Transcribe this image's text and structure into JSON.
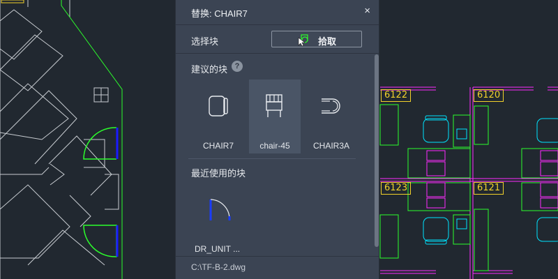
{
  "dialog": {
    "title": "替换: CHAIR7",
    "close_symbol": "×",
    "select_block_label": "选择块",
    "pick_button_label": "拾取",
    "suggested_label": "建议的块",
    "help_symbol": "?",
    "suggested_blocks": [
      "CHAIR7",
      "chair-45",
      "CHAIR3A"
    ],
    "selected_block": "chair-45",
    "recent_label": "最近使用的块",
    "recent_blocks": [
      "DR_UNIT ..."
    ],
    "file_path": "C:\\TF-B-2.dwg"
  },
  "drawing": {
    "room_labels": [
      "6122",
      "6120",
      "6123",
      "6121"
    ]
  },
  "colors": {
    "canvas_bg": "#212830",
    "dialog_bg": "#3b4453",
    "room_label": "#f3d22a",
    "cad_cyan": "#00e5ff",
    "cad_magenta": "#ff2dff",
    "cad_green": "#2cff2c",
    "cad_blue": "#1a1aff"
  }
}
